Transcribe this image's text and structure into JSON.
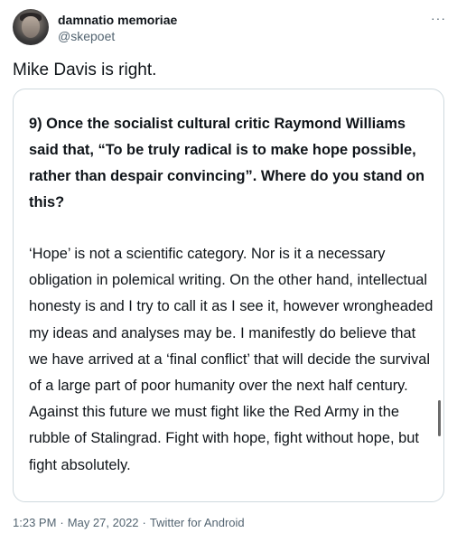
{
  "author": {
    "display_name": "damnatio memoriae",
    "handle": "@skepoet"
  },
  "tweet": {
    "text": "Mike Davis is right."
  },
  "quoted_image": {
    "question": "9) Once the socialist cultural critic Raymond Williams said that, “To be truly radical is to make hope possible, rather than despair convincing”. Where do you stand on this?",
    "answer": "‘Hope’ is not a scientific category. Nor is it a necessary obligation in polemical writing. On the other hand, intellectual honesty is and I try to call it as I see it, however wrongheaded my ideas and analyses may be. I manifestly do believe that we have arrived at a ‘final conflict’ that will decide the survival of a large part of poor humanity over the next half century. Against this future we must fight like the Red Army in the rubble of Stalingrad. Fight with hope, fight without hope, but fight absolutely."
  },
  "meta": {
    "time": "1:23 PM",
    "date": "May 27, 2022",
    "source": "Twitter for Android",
    "separator": "·"
  },
  "icons": {
    "more": "more-options-icon"
  },
  "colors": {
    "text": "#0f1419",
    "secondary": "#536471",
    "border": "#cfd9de"
  }
}
